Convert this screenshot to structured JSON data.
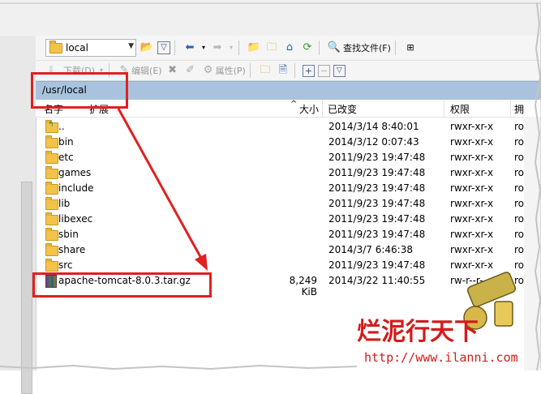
{
  "toolbar": {
    "location_value": "local",
    "find_files_label": "查找文件(F)"
  },
  "toolbar2": {
    "download_label": "下载(D)",
    "edit_label": "编辑(E)",
    "properties_label": "属性(P)"
  },
  "path": "/usr/local",
  "columns": {
    "name": "名字",
    "ext": "扩展",
    "size": "大小",
    "changed": "已改变",
    "rights": "权限",
    "owner": "拥"
  },
  "files": [
    {
      "name": "..",
      "size": "",
      "changed": "2014/3/14 8:40:01",
      "rights": "rwxr-xr-x",
      "owner": "ro",
      "icon": "up-folder-icon"
    },
    {
      "name": "bin",
      "size": "",
      "changed": "2014/3/12 0:07:43",
      "rights": "rwxr-xr-x",
      "owner": "ro",
      "icon": "folder-icon"
    },
    {
      "name": "etc",
      "size": "",
      "changed": "2011/9/23 19:47:48",
      "rights": "rwxr-xr-x",
      "owner": "ro",
      "icon": "folder-icon"
    },
    {
      "name": "games",
      "size": "",
      "changed": "2011/9/23 19:47:48",
      "rights": "rwxr-xr-x",
      "owner": "ro",
      "icon": "folder-icon"
    },
    {
      "name": "include",
      "size": "",
      "changed": "2011/9/23 19:47:48",
      "rights": "rwxr-xr-x",
      "owner": "ro",
      "icon": "folder-icon"
    },
    {
      "name": "lib",
      "size": "",
      "changed": "2011/9/23 19:47:48",
      "rights": "rwxr-xr-x",
      "owner": "ro",
      "icon": "folder-icon"
    },
    {
      "name": "libexec",
      "size": "",
      "changed": "2011/9/23 19:47:48",
      "rights": "rwxr-xr-x",
      "owner": "ro",
      "icon": "folder-icon"
    },
    {
      "name": "sbin",
      "size": "",
      "changed": "2011/9/23 19:47:48",
      "rights": "rwxr-xr-x",
      "owner": "ro",
      "icon": "folder-icon"
    },
    {
      "name": "share",
      "size": "",
      "changed": "2014/3/7 6:46:38",
      "rights": "rwxr-xr-x",
      "owner": "ro",
      "icon": "folder-icon"
    },
    {
      "name": "src",
      "size": "",
      "changed": "2011/9/23 19:47:48",
      "rights": "rwxr-xr-x",
      "owner": "ro",
      "icon": "folder-icon"
    },
    {
      "name": "apache-tomcat-8.0.3.tar.gz",
      "size": "8,249 KiB",
      "changed": "2014/3/22 11:40:55",
      "rights": "rw-r--r--",
      "owner": "ro",
      "icon": "archive-icon"
    }
  ],
  "watermark": {
    "text": "烂泥行天下",
    "url": "http://www.ilanni.com"
  },
  "colors": {
    "annotation": "#e02020",
    "path_bar": "#a9c3de",
    "watermark": "#d21c1c"
  }
}
